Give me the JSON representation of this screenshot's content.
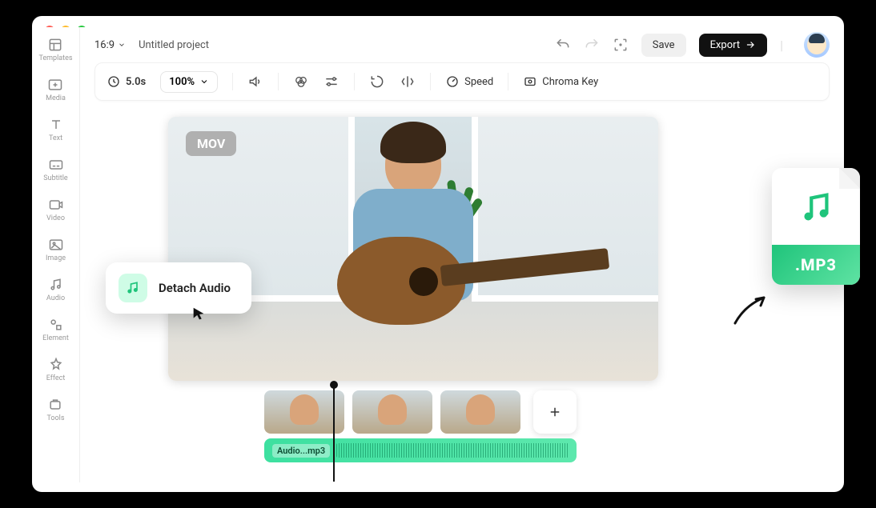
{
  "sidebar": {
    "items": [
      {
        "label": "Templates",
        "icon": "templates-icon"
      },
      {
        "label": "Media",
        "icon": "media-icon"
      },
      {
        "label": "Text",
        "icon": "text-icon"
      },
      {
        "label": "Subtitle",
        "icon": "subtitle-icon"
      },
      {
        "label": "Video",
        "icon": "video-icon"
      },
      {
        "label": "Image",
        "icon": "image-icon"
      },
      {
        "label": "Audio",
        "icon": "audio-icon"
      },
      {
        "label": "Element",
        "icon": "element-icon"
      },
      {
        "label": "Effect",
        "icon": "effect-icon"
      },
      {
        "label": "Tools",
        "icon": "tools-icon"
      }
    ]
  },
  "topbar": {
    "aspect": "16:9",
    "project_title": "Untitled project",
    "save_label": "Save",
    "export_label": "Export"
  },
  "toolbar": {
    "time": "5.0s",
    "zoom": "100%",
    "speed_label": "Speed",
    "chroma_label": "Chroma Key"
  },
  "preview": {
    "format_badge": "MOV"
  },
  "context_menu": {
    "detach_label": "Detach Audio"
  },
  "mp3_card": {
    "ext_label": ".MP3"
  },
  "timeline": {
    "audio_clip_label": "Audio...mp3"
  }
}
